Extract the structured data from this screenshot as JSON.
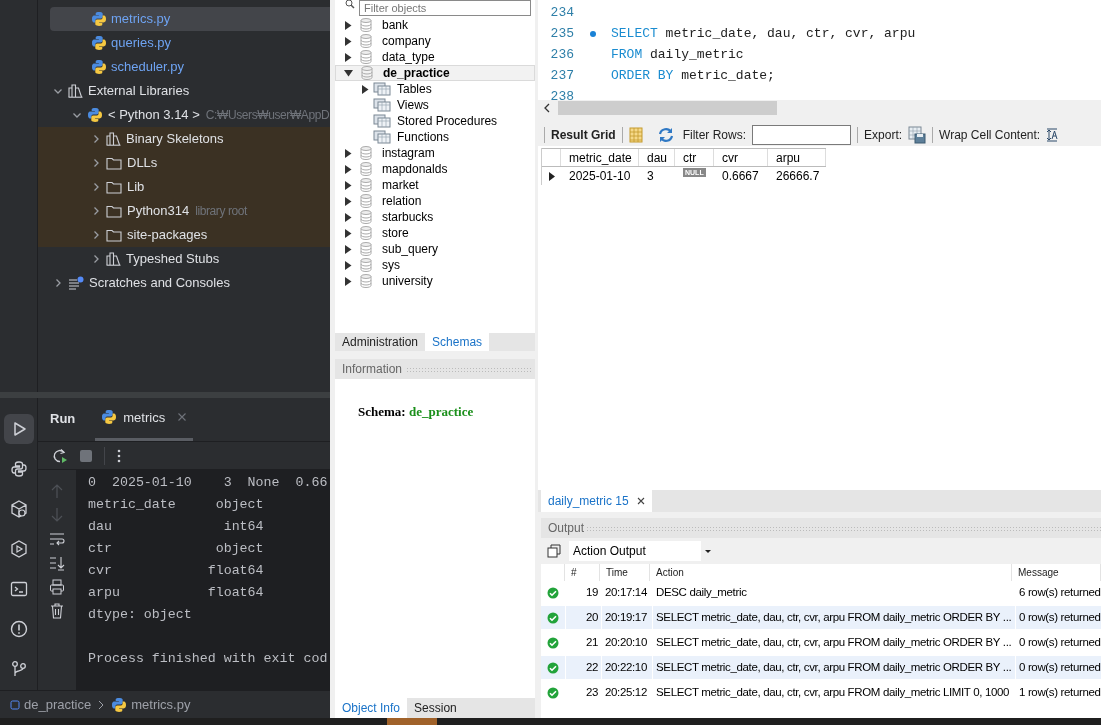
{
  "ide": {
    "files": [
      {
        "label": "metrics.py",
        "selected": true
      },
      {
        "label": "queries.py",
        "selected": false
      },
      {
        "label": "scheduler.py",
        "selected": false
      }
    ],
    "tree": [
      {
        "label": "External Libraries",
        "kind": "library",
        "expanded": true,
        "children": [
          {
            "label": "< Python 3.14 >",
            "hint": "C:₩Users₩user₩AppD",
            "kind": "python",
            "expanded": true,
            "children": [
              {
                "label": "Binary Skeletons",
                "kind": "library",
                "expanded": false,
                "highlighted": true
              },
              {
                "label": "DLLs",
                "kind": "folder",
                "expanded": false,
                "highlighted": true
              },
              {
                "label": "Lib",
                "kind": "folder",
                "expanded": false,
                "highlighted": true
              },
              {
                "label": "Python314",
                "hint": "library root",
                "kind": "folder",
                "expanded": false,
                "highlighted": true
              },
              {
                "label": "site-packages",
                "kind": "folder",
                "expanded": false,
                "highlighted": true
              },
              {
                "label": "Typeshed Stubs",
                "kind": "library",
                "expanded": false,
                "highlighted": false
              }
            ]
          }
        ]
      },
      {
        "label": "Scratches and Consoles",
        "kind": "scratches",
        "expanded": false
      }
    ],
    "run": {
      "title": "Run",
      "tab": "metrics",
      "console": [
        {
          "text": "0  2025-01-10    3  None  0.66"
        },
        {
          "text": "metric_date     object"
        },
        {
          "text": "dau              int64"
        },
        {
          "text": "ctr             object"
        },
        {
          "text": "cvr            float64"
        },
        {
          "text": "arpu           float64"
        },
        {
          "text": "dtype: object"
        }
      ],
      "exit_message": "Process finished with exit cod"
    },
    "breadcrumb": [
      "de_practice",
      "metrics.py"
    ]
  },
  "navigator": {
    "filter": {
      "placeholder": "Filter objects"
    },
    "schemas": [
      {
        "label": "bank",
        "expanded": false,
        "selected": false
      },
      {
        "label": "company",
        "expanded": false,
        "selected": false
      },
      {
        "label": "data_type",
        "expanded": false,
        "selected": false
      },
      {
        "label": "de_practice",
        "expanded": true,
        "selected": true,
        "children": [
          {
            "label": "Tables",
            "expandable": true
          },
          {
            "label": "Views",
            "expandable": false
          },
          {
            "label": "Stored Procedures",
            "expandable": false
          },
          {
            "label": "Functions",
            "expandable": false
          }
        ]
      },
      {
        "label": "instagram",
        "expanded": false,
        "selected": false
      },
      {
        "label": "mapdonalds",
        "expanded": false,
        "selected": false
      },
      {
        "label": "market",
        "expanded": false,
        "selected": false
      },
      {
        "label": "relation",
        "expanded": false,
        "selected": false
      },
      {
        "label": "starbucks",
        "expanded": false,
        "selected": false
      },
      {
        "label": "store",
        "expanded": false,
        "selected": false
      },
      {
        "label": "sub_query",
        "expanded": false,
        "selected": false
      },
      {
        "label": "sys",
        "expanded": false,
        "selected": false
      },
      {
        "label": "university",
        "expanded": false,
        "selected": false
      }
    ],
    "tabs": [
      {
        "label": "Administration",
        "selected": false
      },
      {
        "label": "Schemas",
        "selected": true
      }
    ],
    "info_title": "Information",
    "info_label": "Schema:",
    "info_value": "de_practice",
    "bottom_tabs": [
      {
        "label": "Object Info",
        "selected": true
      },
      {
        "label": "Session",
        "selected": false
      }
    ]
  },
  "editor": {
    "lines": [
      {
        "number": "234",
        "breakpoint": false
      },
      {
        "number": "235",
        "breakpoint": true,
        "tokens": [
          {
            "text": "SELECT",
            "kind": "keyword"
          },
          {
            "text": " metric_date, dau, ctr, cvr, arpu",
            "kind": "plain"
          }
        ]
      },
      {
        "number": "236",
        "breakpoint": false,
        "tokens": [
          {
            "text": "FROM",
            "kind": "keyword"
          },
          {
            "text": " daily_metric",
            "kind": "plain"
          }
        ]
      },
      {
        "number": "237",
        "breakpoint": false,
        "tokens": [
          {
            "text": "ORDER BY",
            "kind": "keyword"
          },
          {
            "text": " metric_date;",
            "kind": "plain"
          }
        ]
      },
      {
        "number": "238",
        "breakpoint": false
      }
    ]
  },
  "result": {
    "toolbar": {
      "title": "Result Grid",
      "filter_label": "Filter Rows:",
      "export_label": "Export:",
      "wrap_label": "Wrap Cell Content:"
    },
    "columns": [
      "metric_date",
      "dau",
      "ctr",
      "cvr",
      "arpu"
    ],
    "rows": [
      [
        {
          "text": "2025-01-10"
        },
        {
          "text": "3"
        },
        {
          "text": "NULL",
          "kind": "null"
        },
        {
          "text": "0.6667"
        },
        {
          "text": "26666.7"
        }
      ]
    ]
  },
  "output": {
    "tab": "daily_metric 15",
    "title": "Output",
    "selector": "Action Output",
    "columns": [
      "#",
      "Time",
      "Action",
      "Message"
    ],
    "rows": [
      {
        "kind": "success",
        "number": "19",
        "time": "20:17:14",
        "action": "DESC daily_metric",
        "message": "6 row(s) returned"
      },
      {
        "kind": "success",
        "number": "20",
        "time": "20:19:17",
        "action": "SELECT metric_date, dau, ctr, cvr, arpu FROM daily_metric ORDER BY ...",
        "message": "0 row(s) returned"
      },
      {
        "kind": "success",
        "number": "21",
        "time": "20:20:10",
        "action": "SELECT metric_date, dau, ctr, cvr, arpu FROM daily_metric ORDER BY ...",
        "message": "0 row(s) returned"
      },
      {
        "kind": "success",
        "number": "22",
        "time": "20:22:10",
        "action": "SELECT metric_date, dau, ctr, cvr, arpu FROM daily_metric ORDER BY ...",
        "message": "0 row(s) returned"
      },
      {
        "kind": "success",
        "number": "23",
        "time": "20:25:12",
        "action": "SELECT metric_date, dau, ctr, cvr, arpu FROM daily_metric LIMIT 0, 1000",
        "message": "1 row(s) returned"
      }
    ]
  }
}
